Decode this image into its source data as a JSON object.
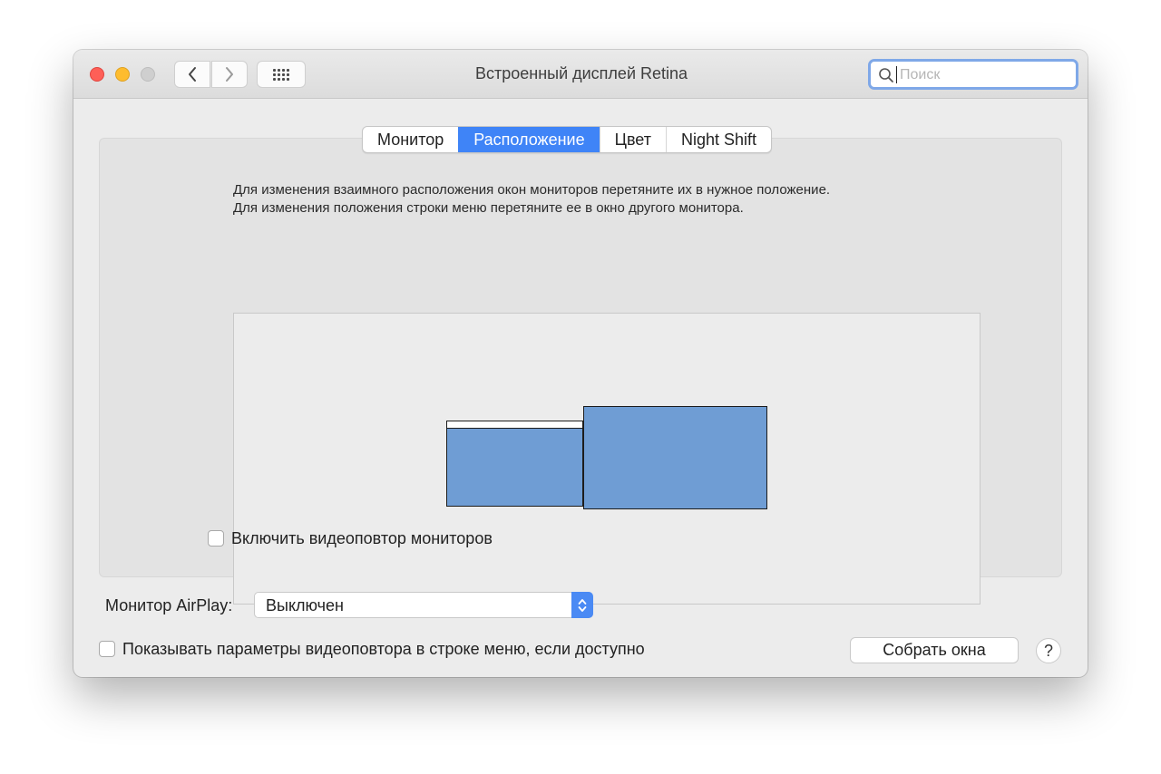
{
  "window": {
    "title": "Встроенный дисплей Retina",
    "search_placeholder": "Поиск"
  },
  "toolbar": {
    "back_icon": "chevron-left-icon",
    "forward_icon": "chevron-right-icon",
    "show_all_icon": "grid-icon"
  },
  "tabs": [
    {
      "label": "Монитор",
      "active": false
    },
    {
      "label": "Расположение",
      "active": true
    },
    {
      "label": "Цвет",
      "active": false
    },
    {
      "label": "Night Shift",
      "active": false
    }
  ],
  "arrangement": {
    "instruction_line1": "Для изменения взаимного расположения окон мониторов перетяните их в нужное положение.",
    "instruction_line2": "Для изменения положения строки меню перетяните ее в окно другого монитора.",
    "monitor_color": "#6f9dd4",
    "mirror_label": "Включить видеоповтор мониторов",
    "mirror_checked": false
  },
  "airplay": {
    "label": "Монитор AirPlay:",
    "value": "Выключен"
  },
  "footer": {
    "show_in_menu_label": "Показывать параметры видеоповтора в строке меню, если доступно",
    "show_in_menu_checked": false,
    "gather_button": "Собрать окна",
    "help_button": "?"
  },
  "colors": {
    "accent": "#3f84f7",
    "close": "#fe5f57",
    "minimize": "#febc2e"
  }
}
